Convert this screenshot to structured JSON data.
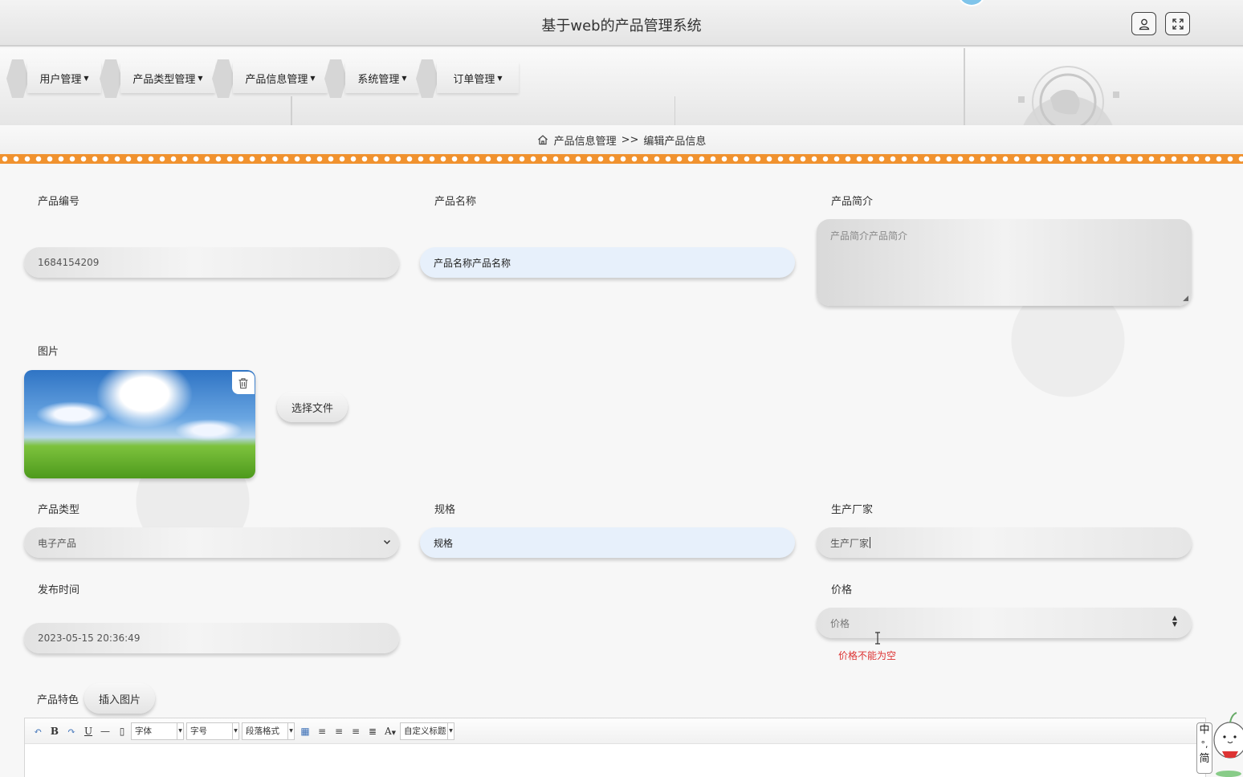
{
  "header": {
    "title": "基于web的产品管理系统",
    "user_icon": "user-icon",
    "fullscreen_icon": "fullscreen-icon"
  },
  "nav": {
    "items": [
      {
        "label": "用户管理"
      },
      {
        "label": "产品类型管理"
      },
      {
        "label": "产品信息管理"
      },
      {
        "label": "系统管理"
      },
      {
        "label": "订单管理"
      }
    ]
  },
  "breadcrumb": {
    "home_icon": "home-icon",
    "section": "产品信息管理",
    "separator": ">>",
    "current": "编辑产品信息"
  },
  "form": {
    "product_no": {
      "label": "产品编号",
      "value": "1684154209"
    },
    "product_name": {
      "label": "产品名称",
      "value": "产品名称产品名称"
    },
    "product_intro": {
      "label": "产品简介",
      "value": "产品简介产品简介"
    },
    "image": {
      "label": "图片",
      "choose_button": "选择文件",
      "delete_icon": "trash-icon"
    },
    "product_type": {
      "label": "产品类型",
      "value": "电子产品"
    },
    "spec": {
      "label": "规格",
      "value": "规格"
    },
    "manufacturer": {
      "label": "生产厂家",
      "value": "生产厂家"
    },
    "publish_time": {
      "label": "发布时间",
      "value": "2023-05-15 20:36:49"
    },
    "price": {
      "label": "价格",
      "placeholder": "价格",
      "error": "价格不能为空"
    },
    "features": {
      "label": "产品特色",
      "insert_image_button": "插入图片"
    }
  },
  "editor": {
    "font_combo": "字体",
    "size_combo": "字号",
    "paragraph_combo": "段落格式",
    "custom_title_combo": "自定义标题",
    "bold": "B",
    "underline": "U",
    "font_color": "A"
  },
  "ime": {
    "lang": "中",
    "mode": "简",
    "punct": "°,"
  },
  "colors": {
    "accent_orange": "#f0922f",
    "error_red": "#dd3333",
    "active_field": "#e7f0fb"
  }
}
